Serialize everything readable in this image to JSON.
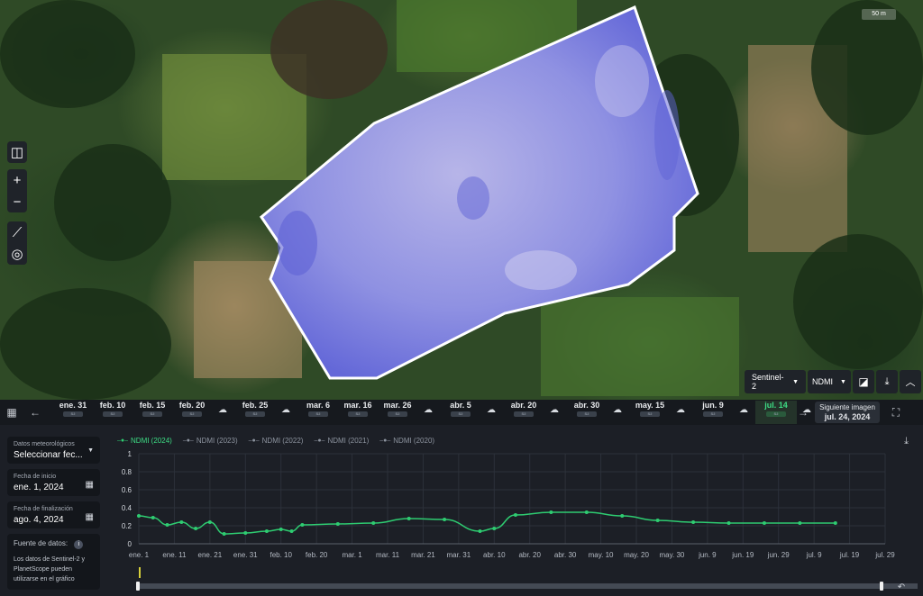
{
  "map": {
    "scale_label": "50 m",
    "tools": [
      {
        "name": "compare-icon",
        "glyph": "◫"
      },
      {
        "name": "zoom-in-icon",
        "glyph": "+"
      },
      {
        "name": "zoom-out-icon",
        "glyph": "−"
      },
      {
        "name": "ruler-icon",
        "glyph": "⟋"
      },
      {
        "name": "locate-icon",
        "glyph": "◎"
      }
    ],
    "satellite": "Sentinel-2",
    "index": "NDMI",
    "field_color": "#7b7fe0"
  },
  "timeline": {
    "items": [
      {
        "kind": "date",
        "label": "ene. 31",
        "tag": "S2"
      },
      {
        "kind": "date",
        "label": "feb. 10",
        "tag": "S2"
      },
      {
        "kind": "date",
        "label": "feb. 15",
        "tag": "S2"
      },
      {
        "kind": "date",
        "label": "feb. 20",
        "tag": "S2"
      },
      {
        "kind": "cloud"
      },
      {
        "kind": "date",
        "label": "feb. 25",
        "tag": "S2"
      },
      {
        "kind": "cloud"
      },
      {
        "kind": "date",
        "label": "mar. 6",
        "tag": "S2"
      },
      {
        "kind": "date",
        "label": "mar. 16",
        "tag": "S2"
      },
      {
        "kind": "date",
        "label": "mar. 26",
        "tag": "S2"
      },
      {
        "kind": "cloud"
      },
      {
        "kind": "date",
        "label": "abr. 5",
        "tag": "S2"
      },
      {
        "kind": "cloud"
      },
      {
        "kind": "date",
        "label": "abr. 20",
        "tag": "S2"
      },
      {
        "kind": "cloud"
      },
      {
        "kind": "date",
        "label": "abr. 30",
        "tag": "S2"
      },
      {
        "kind": "cloud"
      },
      {
        "kind": "date",
        "label": "may. 15",
        "tag": "S2"
      },
      {
        "kind": "cloud"
      },
      {
        "kind": "date",
        "label": "jun. 9",
        "tag": "S2"
      },
      {
        "kind": "cloud"
      },
      {
        "kind": "date",
        "label": "jul. 14",
        "tag": "S2",
        "active": true
      },
      {
        "kind": "cloud"
      }
    ],
    "next_label": "Siguiente imagen",
    "next_date": "jul. 24, 2024"
  },
  "sidebar": {
    "weather_label": "Datos meteorológicos",
    "weather_value": "Seleccionar fec...",
    "start_label": "Fecha de inicio",
    "start_value": "ene. 1, 2024",
    "end_label": "Fecha de finalización",
    "end_value": "ago. 4, 2024",
    "source_title": "Fuente de datos:",
    "source_text": "Los datos de Sentinel-2 y PlanetScope pueden utilizarse en el gráfico"
  },
  "chart_data": {
    "type": "line",
    "series": [
      {
        "name": "NDMI (2024)",
        "color": "#2ecc71",
        "points": [
          [
            0,
            0.31
          ],
          [
            4,
            0.29
          ],
          [
            8,
            0.21
          ],
          [
            12,
            0.24
          ],
          [
            16,
            0.17
          ],
          [
            20,
            0.24
          ],
          [
            24,
            0.11
          ],
          [
            30,
            0.12
          ],
          [
            36,
            0.14
          ],
          [
            40,
            0.16
          ],
          [
            43,
            0.14
          ],
          [
            46,
            0.21
          ],
          [
            56,
            0.22
          ],
          [
            66,
            0.23
          ],
          [
            76,
            0.28
          ],
          [
            86,
            0.27
          ],
          [
            96,
            0.14
          ],
          [
            100,
            0.17
          ],
          [
            106,
            0.32
          ],
          [
            116,
            0.35
          ],
          [
            126,
            0.35
          ],
          [
            136,
            0.31
          ],
          [
            146,
            0.26
          ],
          [
            156,
            0.24
          ],
          [
            166,
            0.23
          ],
          [
            176,
            0.23
          ],
          [
            186,
            0.23
          ],
          [
            196,
            0.23
          ]
        ]
      },
      {
        "name": "NDMI (2023)",
        "color": "#8c939e",
        "points": []
      },
      {
        "name": "NDMI (2022)",
        "color": "#8c939e",
        "points": []
      },
      {
        "name": "NDMI (2021)",
        "color": "#8c939e",
        "points": []
      },
      {
        "name": "NDMI (2020)",
        "color": "#8c939e",
        "points": []
      }
    ],
    "x_ticks": [
      "ene. 1",
      "ene. 11",
      "ene. 21",
      "ene. 31",
      "feb. 10",
      "feb. 20",
      "mar. 1",
      "mar. 11",
      "mar. 21",
      "mar. 31",
      "abr. 10",
      "abr. 20",
      "abr. 30",
      "may. 10",
      "may. 20",
      "may. 30",
      "jun. 9",
      "jun. 19",
      "jun. 29",
      "jul. 9",
      "jul. 19",
      "jul. 29"
    ],
    "y_ticks": [
      "0",
      "0.2",
      "0.4",
      "0.6",
      "0.8",
      "1"
    ],
    "ylim": [
      0,
      1
    ],
    "grid": true,
    "legend": "top-left"
  }
}
